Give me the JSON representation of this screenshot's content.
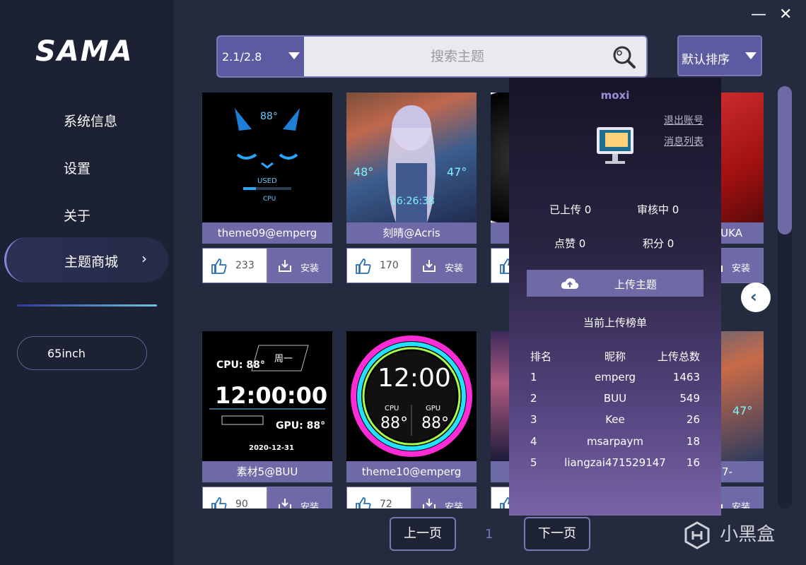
{
  "app": {
    "logo": "SAMA"
  },
  "window": {
    "minimize": "—",
    "close": "✕"
  },
  "sidebar": {
    "items": [
      {
        "label": "系统信息"
      },
      {
        "label": "设置"
      },
      {
        "label": "关于"
      },
      {
        "label": "主题商城",
        "active": true,
        "chevron": "›"
      }
    ],
    "device": "65inch"
  },
  "search": {
    "version": "2.1/2.8",
    "placeholder": "搜索主题",
    "sort": "默认排序"
  },
  "themes": [
    {
      "title": "theme09@emperg",
      "likes": "233",
      "install": "安装",
      "art": {
        "temp": "88°",
        "used": "USED",
        "cpu": "CPU"
      }
    },
    {
      "title": "刻晴@Acris",
      "likes": "170",
      "install": "安装"
    },
    {
      "title": "",
      "likes": "",
      "install": ""
    },
    {
      "title": "UKA",
      "likes": "",
      "install": "安装"
    },
    {
      "title": "素材5@BUU",
      "likes": "90",
      "install": "安装",
      "art": {
        "cpu": "CPU: 88°",
        "day": "周一",
        "time": "12:00:00",
        "gpu": "GPU: 88°",
        "date": "2020-12-31"
      }
    },
    {
      "title": "theme10@emperg",
      "likes": "72",
      "install": "安装",
      "art": {
        "time": "12:00",
        "cpu_label": "CPU",
        "gpu_label": "GPU",
        "cpu": "88°",
        "gpu": "88°"
      }
    },
    {
      "title": "",
      "likes": "",
      "install": ""
    },
    {
      "title": "7-",
      "likes": "",
      "install": "安装"
    }
  ],
  "panel": {
    "username": "moxi",
    "logout": "退出账号",
    "messages": "消息列表",
    "uploaded": "已上传 0",
    "reviewing": "审核中 0",
    "likes": "点赞 0",
    "points": "积分 0",
    "upload_button": "上传主题",
    "ranking_title": "当前上传榜单",
    "ranking_headers": [
      "排名",
      "昵称",
      "上传总数"
    ],
    "ranking": [
      {
        "rank": "1",
        "name": "emperg",
        "total": "1463"
      },
      {
        "rank": "2",
        "name": "BUU",
        "total": "549"
      },
      {
        "rank": "3",
        "name": "Kee",
        "total": "26"
      },
      {
        "rank": "4",
        "name": "msarpaym",
        "total": "18"
      },
      {
        "rank": "5",
        "name": "liangzai471529147",
        "total": "16"
      }
    ]
  },
  "pagination": {
    "prev": "上一页",
    "page": "1",
    "next": "下一页"
  },
  "watermark": "小黑盒",
  "colors": {
    "accent": "#6e6aa8",
    "sidebar": "#1c2233",
    "background": "#252b3f"
  }
}
